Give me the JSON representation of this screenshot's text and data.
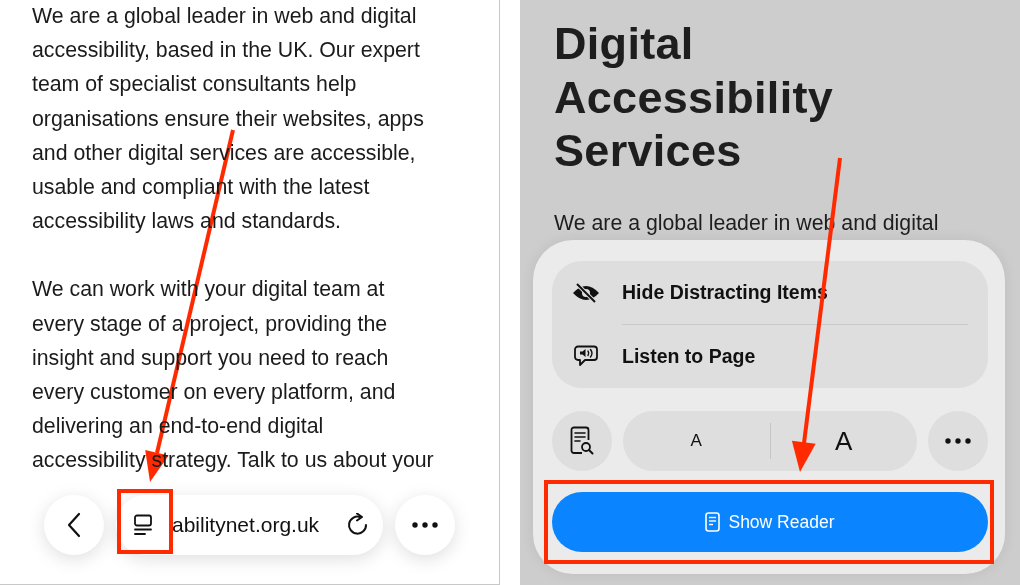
{
  "left_screen": {
    "paragraphs": [
      {
        "lines": [
          "We are a global leader in web and digital",
          "accessibility, based in the UK. Our expert",
          "team of specialist consultants help",
          "organisations ensure their websites, apps",
          "and other digital services are accessible,",
          "usable and compliant with the latest",
          "accessibility laws and standards."
        ]
      },
      {
        "lines": [
          "We can work with your digital team at",
          "every stage of a project, providing the",
          "insight and support you need to reach",
          "every customer on every platform, and",
          "delivering an end-to-end digital",
          "accessibility strategy. Talk to us about your"
        ]
      }
    ],
    "toolbar": {
      "address": "abilitynet.org.uk",
      "reader_button": {
        "highlighted": true
      }
    }
  },
  "right_screen": {
    "heading_lines": [
      "Digital",
      "Accessibility",
      "Services"
    ],
    "paragraph_start": "We are a global leader in web and digital",
    "menu": {
      "items": [
        {
          "label": "Hide Distracting Items",
          "kind": "hide"
        },
        {
          "label": "Listen to Page",
          "kind": "listen"
        }
      ],
      "text_size": {
        "smaller": "A",
        "larger": "A"
      },
      "show_reader": {
        "label": "Show Reader",
        "highlighted": true
      }
    }
  }
}
